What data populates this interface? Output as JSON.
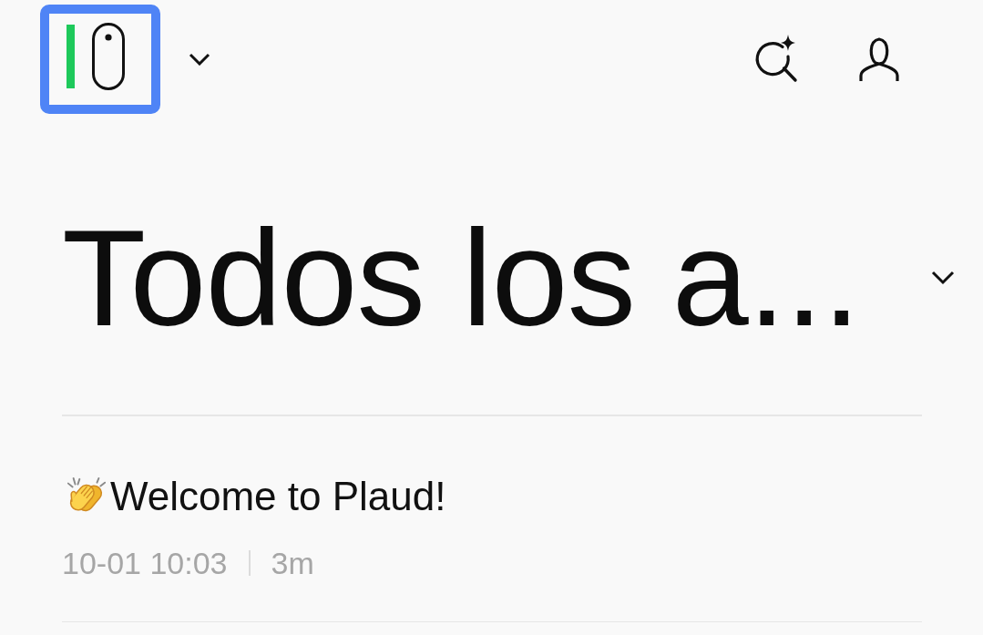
{
  "header": {
    "logo_button": {
      "highlighted": true
    }
  },
  "folder": {
    "title": "Todos los a..."
  },
  "recordings": [
    {
      "title": "Welcome to Plaud!",
      "date": "10-01 10:03",
      "duration": "3m"
    }
  ]
}
